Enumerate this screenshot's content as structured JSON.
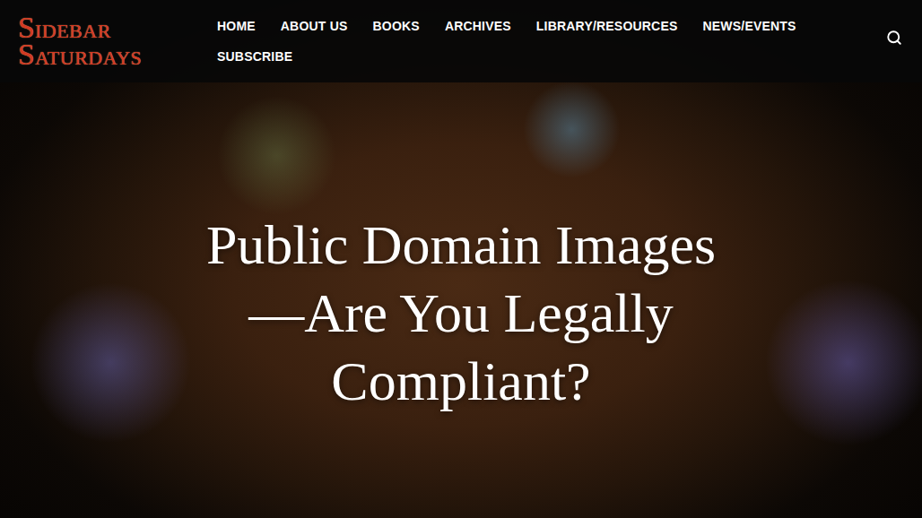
{
  "header": {
    "logo": [
      {
        "initial": "S",
        "rest": "IDEBAR"
      },
      {
        "initial": "S",
        "rest": "ATURDAYS"
      }
    ],
    "nav": [
      {
        "label": "HOME",
        "selected": false
      },
      {
        "label": "ABOUT US",
        "selected": false
      },
      {
        "label": "BOOKS",
        "selected": false
      },
      {
        "label": "ARCHIVES",
        "selected": false
      },
      {
        "label": "LIBRARY/RESOURCES",
        "selected": false
      },
      {
        "label": "NEWS/EVENTS",
        "selected": false
      },
      {
        "label": "SUBSCRIBE",
        "selected": false
      }
    ]
  },
  "hero": {
    "title": "Public Domain Images—Are You Legally Compliant?"
  }
}
